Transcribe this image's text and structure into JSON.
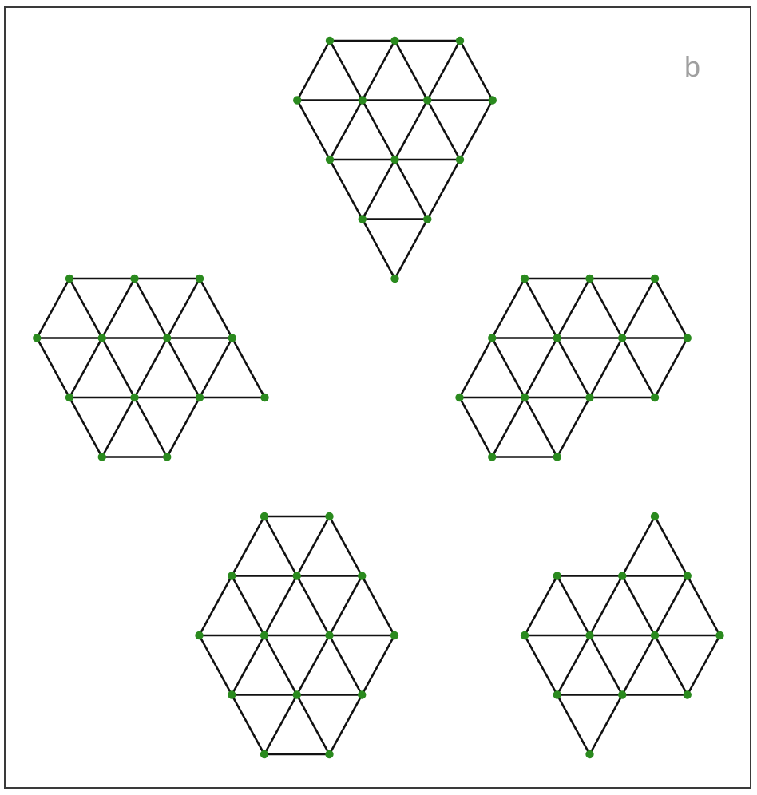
{
  "panel_label": "b",
  "colors": {
    "node": "#2a8a1e",
    "edge": "#111111",
    "frame": "#3a3a3a",
    "label": "#a0a0a0"
  },
  "graphs": [
    {
      "name": "graph-top",
      "nodes": [
        [
          0,
          0
        ],
        [
          1,
          0
        ],
        [
          2,
          0
        ],
        [
          -0.5,
          1
        ],
        [
          0.5,
          1
        ],
        [
          1.5,
          1
        ],
        [
          2.5,
          1
        ],
        [
          0,
          2
        ],
        [
          1,
          2
        ],
        [
          2,
          2
        ],
        [
          0.5,
          3
        ],
        [
          1.5,
          3
        ],
        [
          1,
          4
        ]
      ]
    },
    {
      "name": "graph-middle-left",
      "nodes": [
        [
          0,
          0
        ],
        [
          1,
          0
        ],
        [
          2,
          0
        ],
        [
          -0.5,
          1
        ],
        [
          0.5,
          1
        ],
        [
          1.5,
          1
        ],
        [
          2.5,
          1
        ],
        [
          0,
          2
        ],
        [
          1,
          2
        ],
        [
          2,
          2
        ],
        [
          3,
          2
        ],
        [
          0.5,
          3
        ],
        [
          1.5,
          3
        ]
      ]
    },
    {
      "name": "graph-middle-right",
      "nodes": [
        [
          0,
          0
        ],
        [
          1,
          0
        ],
        [
          2,
          0
        ],
        [
          -0.5,
          1
        ],
        [
          0.5,
          1
        ],
        [
          1.5,
          1
        ],
        [
          2.5,
          1
        ],
        [
          -1,
          2
        ],
        [
          0,
          2
        ],
        [
          1,
          2
        ],
        [
          2,
          2
        ],
        [
          -0.5,
          3
        ],
        [
          0.5,
          3
        ]
      ]
    },
    {
      "name": "graph-bottom-left",
      "nodes": [
        [
          0,
          0
        ],
        [
          1,
          0
        ],
        [
          -0.5,
          1
        ],
        [
          0.5,
          1
        ],
        [
          1.5,
          1
        ],
        [
          -1,
          2
        ],
        [
          0,
          2
        ],
        [
          1,
          2
        ],
        [
          2,
          2
        ],
        [
          -0.5,
          3
        ],
        [
          0.5,
          3
        ],
        [
          1.5,
          3
        ],
        [
          0,
          4
        ],
        [
          1,
          4
        ]
      ]
    },
    {
      "name": "graph-bottom-right",
      "nodes": [
        [
          2,
          0
        ],
        [
          0.5,
          1
        ],
        [
          1.5,
          1
        ],
        [
          2.5,
          1
        ],
        [
          0,
          2
        ],
        [
          1,
          2
        ],
        [
          2,
          2
        ],
        [
          3,
          2
        ],
        [
          0.5,
          3
        ],
        [
          1.5,
          3
        ],
        [
          2.5,
          3
        ],
        [
          1,
          4
        ]
      ]
    }
  ]
}
